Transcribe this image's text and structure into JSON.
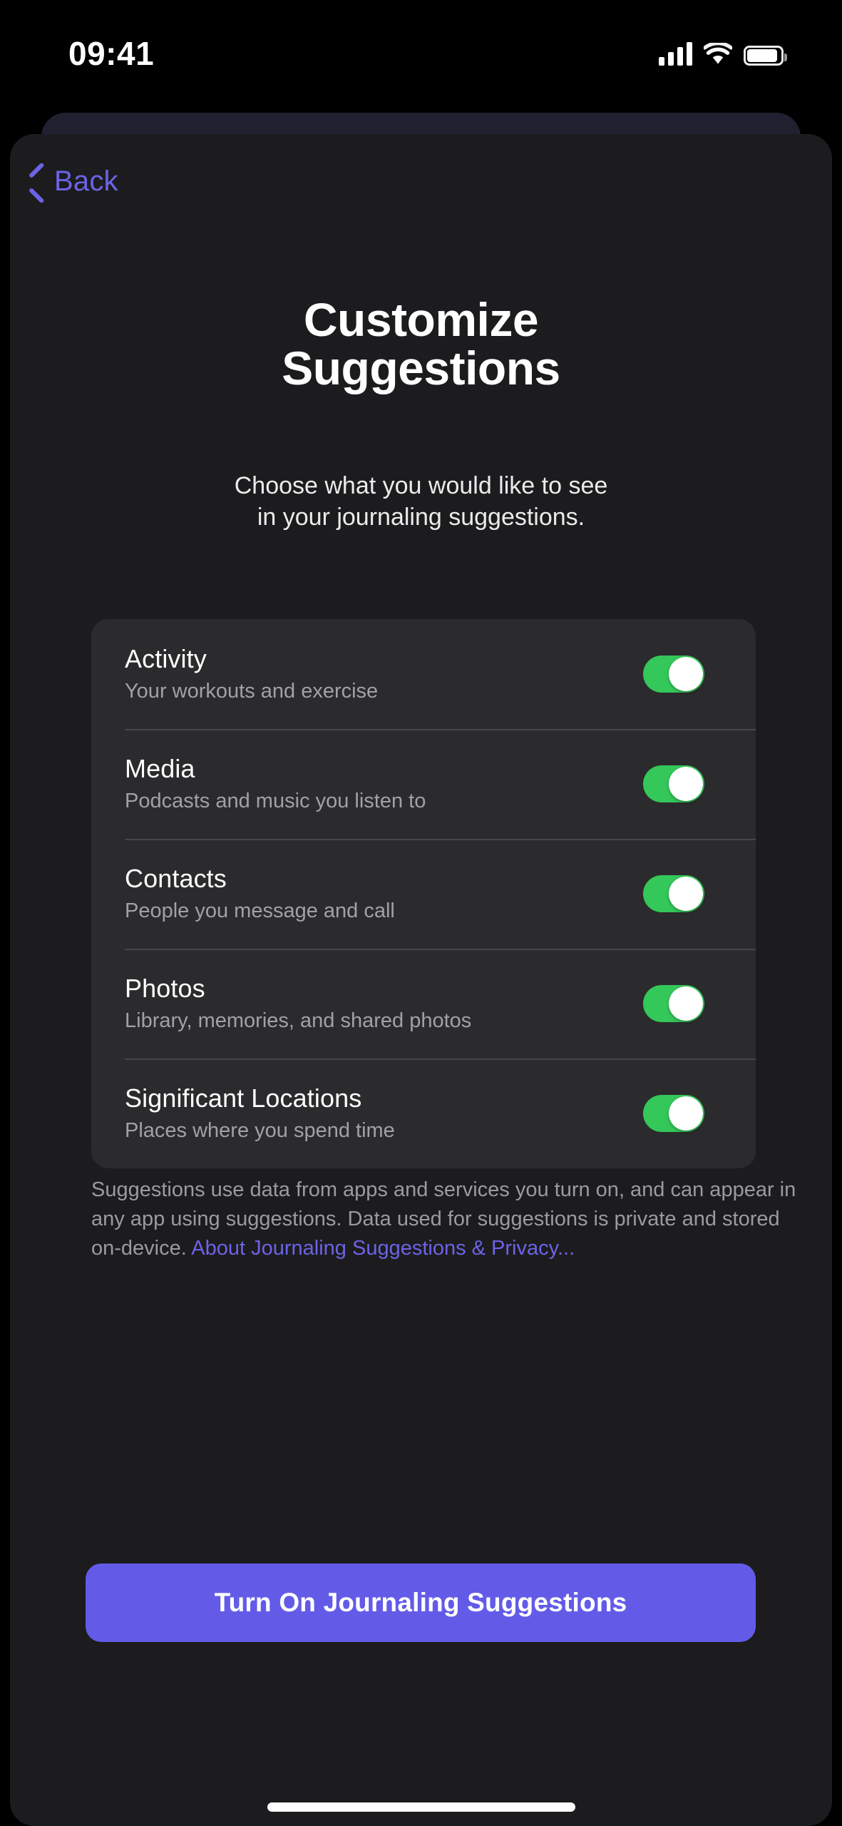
{
  "status_bar": {
    "time": "09:41",
    "cellular_icon": "cellular-bars-icon",
    "wifi_icon": "wifi-icon",
    "battery_icon": "battery-icon"
  },
  "nav": {
    "back_label": "Back",
    "back_icon": "chevron-left-icon",
    "accent_color": "#6C63E8"
  },
  "header": {
    "title_line1": "Customize",
    "title_line2": "Suggestions",
    "subtitle_line1": "Choose what you would like to see",
    "subtitle_line2": "in your journaling suggestions."
  },
  "options": [
    {
      "title": "Activity",
      "subtitle": "Your workouts and exercise",
      "enabled": true,
      "toggle_state": "on"
    },
    {
      "title": "Media",
      "subtitle": "Podcasts and music you listen to",
      "enabled": true,
      "toggle_state": "on"
    },
    {
      "title": "Contacts",
      "subtitle": "People you message and call",
      "enabled": true,
      "toggle_state": "on"
    },
    {
      "title": "Photos",
      "subtitle": "Library, memories, and shared photos",
      "enabled": true,
      "toggle_state": "on"
    },
    {
      "title": "Significant Locations",
      "subtitle": "Places where you spend time",
      "enabled": true,
      "toggle_state": "on"
    }
  ],
  "footnote": {
    "body": "Suggestions use data from apps and services you turn on, and can appear in any app using suggestions. Data used for suggestions is private and stored on-device. ",
    "link_text": "About Journaling Suggestions & Privacy..."
  },
  "cta": {
    "label": "Turn On Journaling Suggestions",
    "color": "#635BE8"
  },
  "colors": {
    "toggle_on": "#34C759",
    "sheet_background": "#1C1C1E",
    "card_background": "#2B2B2D",
    "accent_purple": "#6C63E8"
  }
}
